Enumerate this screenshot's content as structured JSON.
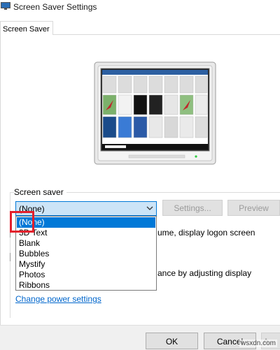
{
  "window": {
    "title": "Screen Saver Settings",
    "app_icon": "monitor-icon"
  },
  "tabs": [
    {
      "label": "Screen Saver",
      "active": true
    }
  ],
  "preview": {
    "icon": "monitor-preview"
  },
  "screen_saver_group": {
    "label": "Screen saver",
    "selected": "(None)",
    "options": [
      "(None)",
      "3D Text",
      "Blank",
      "Bubbles",
      "Mystify",
      "Photos",
      "Ribbons"
    ],
    "settings_label": "Settings...",
    "preview_label": "Preview",
    "logon_text_fragment": "ume, display logon screen"
  },
  "power_group": {
    "text_fragment": "ance by adjusting display",
    "link_label": "Change power settings"
  },
  "footer": {
    "ok_label": "OK",
    "cancel_label": "Cancel",
    "apply_label": "A"
  },
  "watermark": "wsxdn.com",
  "colors": {
    "selection": "#0078d7",
    "highlight_box": "#e3202c",
    "link": "#0066cc",
    "combo_bg": "#cce4f7"
  }
}
